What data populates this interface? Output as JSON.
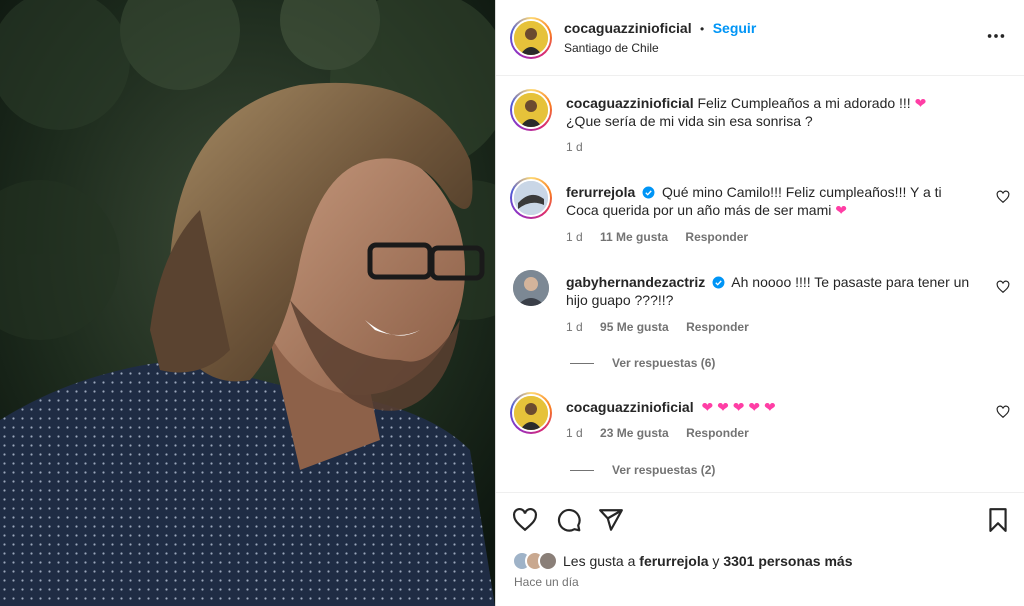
{
  "post": {
    "author": "cocaguazzinioficial",
    "separator": "•",
    "follow_label": "Seguir",
    "location": "Santiago de Chile",
    "caption": {
      "username": "cocaguazzinioficial",
      "text_line1": "Feliz Cumpleaños a mi adorado !!!",
      "text_line2": "¿Que sería de mi vida sin esa sonrisa ?",
      "emoji": "❤",
      "time": "1 d"
    }
  },
  "comments": [
    {
      "username": "ferurrejola",
      "verified": true,
      "text_line1": "Qué mino Camilo!!! Feliz cumpleaños!!! Y a ti",
      "text_line2": "Coca querida por un año más de ser mami",
      "emoji": "❤",
      "time": "1 d",
      "likes": "11 Me gusta",
      "reply_label": "Responder"
    },
    {
      "username": "gabyhernandezactriz",
      "verified": true,
      "text_line1": "Ah noooo !!!! Te pasaste para tener un",
      "text_line2": "hijo guapo ???!!?",
      "time": "1 d",
      "likes": "95 Me gusta",
      "reply_label": "Responder",
      "view_replies": "Ver respuestas (6)"
    },
    {
      "username": "cocaguazzinioficial",
      "verified": false,
      "text_line1": "❤ ❤ ❤ ❤ ❤",
      "time": "1 d",
      "likes": "23 Me gusta",
      "reply_label": "Responder",
      "view_replies": "Ver respuestas (2)"
    }
  ],
  "footer": {
    "likes_prefix": "Les gusta a",
    "likes_user": "ferurrejola",
    "likes_and": "y",
    "likes_count": "3301 personas más",
    "time": "Hace un día"
  },
  "colors": {
    "link_blue": "#0095f6",
    "verified_blue": "#0095f6",
    "heart_pink": "#ff3ea5",
    "text": "#262626",
    "muted": "#737373"
  },
  "icons": [
    "more-options-icon",
    "heart-icon",
    "comment-icon",
    "share-icon",
    "bookmark-icon",
    "verified-badge-icon"
  ]
}
